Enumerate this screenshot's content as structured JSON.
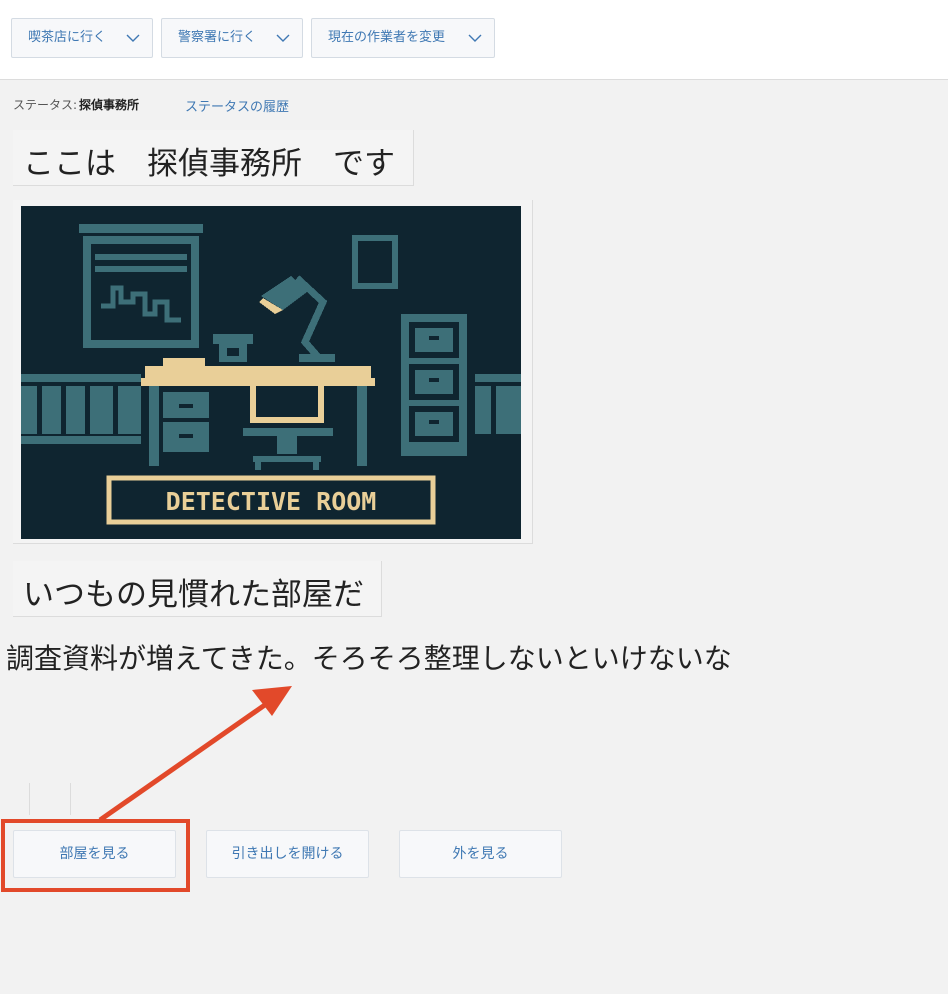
{
  "header": {
    "dropdowns": [
      {
        "label": "喫茶店に行く"
      },
      {
        "label": "警察署に行く"
      },
      {
        "label": "現在の作業者を変更"
      }
    ]
  },
  "status": {
    "prefix": "ステータス:",
    "value": "探偵事務所",
    "history_link": "ステータスの履歴"
  },
  "main": {
    "location_text": "ここは　探偵事務所　です",
    "image_caption": "DETECTIVE ROOM",
    "subtitle": "いつもの見慣れた部屋だ",
    "body": "調査資料が増えてきた。そろそろ整理しないといけないな"
  },
  "actions": [
    {
      "label": "部屋を見る"
    },
    {
      "label": "引き出しを開ける"
    },
    {
      "label": "外を見る"
    }
  ],
  "colors": {
    "accent": "#3f78b3",
    "highlight": "#e2492a",
    "scene_bg": "#0f2530",
    "scene_teal": "#3d6f78",
    "scene_cream": "#e9cf98"
  },
  "icons": {
    "dropdown": "chevron-down-icon",
    "annotation": "arrow-annotation"
  }
}
